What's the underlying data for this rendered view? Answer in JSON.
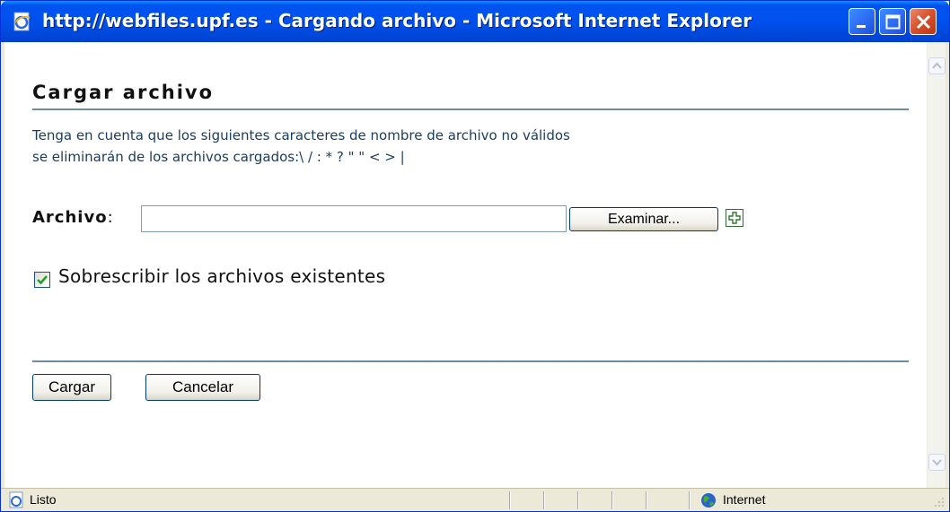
{
  "window": {
    "title": "http://webfiles.upf.es - Cargando archivo - Microsoft Internet Explorer",
    "icon": "ie-page-icon",
    "controls": [
      "minimize-icon",
      "maximize-icon",
      "close-icon"
    ],
    "title_color": "#0054e3"
  },
  "form": {
    "heading": "Cargar archivo",
    "description_line1": "Tenga en cuenta que los siguientes caracteres de nombre de archivo no válidos",
    "description_line2": "se eliminarán de los archivos cargados:\\ / : * ? \" \" < > |",
    "file_label": "Archivo",
    "file_label_colon": ":",
    "file_value": "",
    "browse_label": "Examinar...",
    "add_icon": "plus-icon",
    "overwrite_label": "Sobrescribir los archivos existentes",
    "overwrite_checked": true,
    "submit_label": "Cargar",
    "cancel_label": "Cancelar"
  },
  "statusbar": {
    "status_text": "Listo",
    "zone_text": "Internet",
    "status_icon": "ie-page-icon",
    "zone_icon": "globe-icon"
  }
}
